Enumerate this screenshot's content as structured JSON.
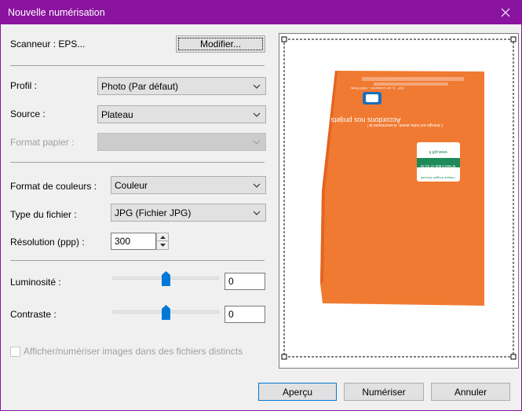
{
  "window": {
    "title": "Nouvelle numérisation",
    "accent": "#8a139f"
  },
  "scanner": {
    "label": "Scanneur : EPS...",
    "modify_button": "Modifier..."
  },
  "profile": {
    "label": "Profil :",
    "value": "Photo (Par défaut)"
  },
  "source": {
    "label": "Source :",
    "value": "Plateau"
  },
  "paper_format": {
    "label": "Format papier :",
    "value": ""
  },
  "color_format": {
    "label": "Format de couleurs :",
    "value": "Couleur"
  },
  "file_type": {
    "label": "Type du fichier :",
    "value": "JPG (Fichier JPG)"
  },
  "resolution": {
    "label": "Résolution (ppp) :",
    "value": "300"
  },
  "brightness": {
    "label": "Luminosité :",
    "value": "0",
    "level": 0.5
  },
  "contrast": {
    "label": "Contraste :",
    "value": "0",
    "level": 0.5
  },
  "separate_files": {
    "label": "Afficher/numériser images dans des fichiers distincts",
    "checked": false
  },
  "preview": {
    "document_color": "#f07a32",
    "texts": {
      "brand": "Accordons nos projets",
      "address": "GDF · 8, rue Condorcet – 75009 Paris",
      "note": "L'énergie est notre avenir, économisons-la !",
      "box_title": "Chaque d'Appel Sécurité",
      "box_phone": "N°Vert 0 800 47 33 33",
      "box_web": "www.gdf.fr"
    }
  },
  "buttons": {
    "preview": "Aperçu",
    "scan": "Numériser",
    "cancel": "Annuler"
  }
}
